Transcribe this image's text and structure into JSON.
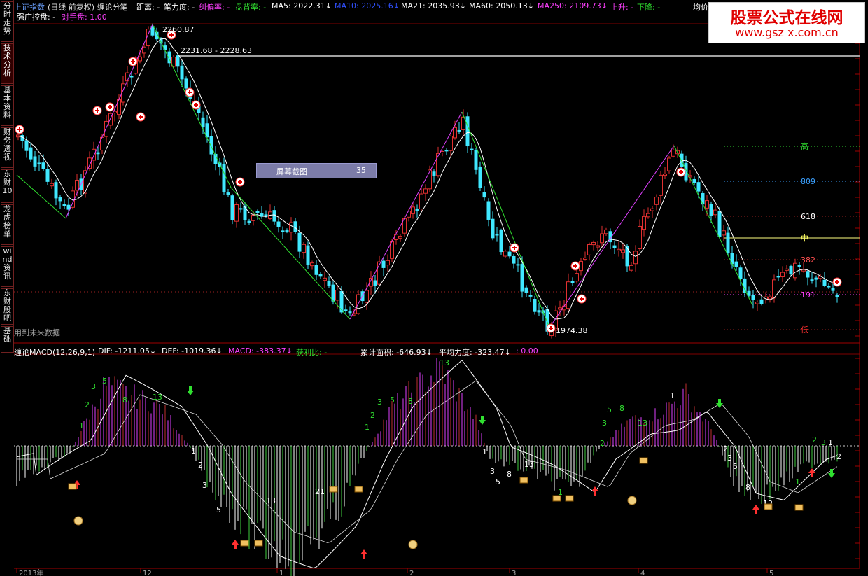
{
  "sidebar": {
    "tabs": [
      {
        "label": "分时走势",
        "active": false
      },
      {
        "label": "技术分析",
        "active": true
      },
      {
        "label": "基本资料",
        "active": false
      },
      {
        "label": "财务透视",
        "active": false
      },
      {
        "label": "东财10",
        "active": false
      },
      {
        "label": "龙虎榜单",
        "active": false
      },
      {
        "label": "wind资讯",
        "active": false
      },
      {
        "label": "东财股吧",
        "active": false
      },
      {
        "label": "基础",
        "active": false
      }
    ]
  },
  "header": {
    "row1": [
      {
        "text": "上证指数",
        "color": "#6aa0ff"
      },
      {
        "text": "(日线 前复权) 缠论分笔",
        "color": "#dddddd"
      },
      {
        "text": "距离: -",
        "color": "#ffffff"
      },
      {
        "text": "笔力度: -",
        "color": "#ffffff"
      },
      {
        "text": "纠偏率: -",
        "color": "#ff40ff"
      },
      {
        "text": "盘背率: -",
        "color": "#30e030"
      },
      {
        "text": "MA5: 2022.31↓",
        "color": "#ffffff"
      },
      {
        "text": "MA10: 2025.16↓",
        "color": "#3050ff"
      },
      {
        "text": "MA21: 2035.93↓",
        "color": "#ffffff"
      },
      {
        "text": "MA60: 2050.13↓",
        "color": "#ffffff"
      },
      {
        "text": "MA250: 2109.73↓",
        "color": "#ff40ff"
      },
      {
        "text": "上升: -",
        "color": "#ff40ff"
      },
      {
        "text": "下降: -",
        "color": "#30e030"
      },
      {
        "text": "均价",
        "color": "#ffffff"
      }
    ],
    "row2": [
      {
        "text": "强庄控盘: -",
        "color": "#ffffff"
      },
      {
        "text": "对手盘: 1.00",
        "color": "#ff40ff"
      }
    ]
  },
  "watermark": {
    "title": "股票公式在线网",
    "url": "www.gsz x.com.cn"
  },
  "screenshot_tip": {
    "label": "屏幕截图",
    "count": "35"
  },
  "price_chart": {
    "high_label": "2260.87",
    "range_label": "2231.68 - 2228.63",
    "low_label": "1974.38",
    "future_label": "用到未来数据",
    "fib_levels": [
      {
        "label": "高",
        "color": "#30e030"
      },
      {
        "label": "809",
        "color": "#3aa0ff"
      },
      {
        "label": "618",
        "color": "#ffffff"
      },
      {
        "label": "中",
        "color": "#ffff60"
      },
      {
        "label": "382",
        "color": "#ff5050"
      },
      {
        "label": "191",
        "color": "#ff40ff"
      },
      {
        "label": "低",
        "color": "#ff3030"
      }
    ]
  },
  "macd_header": [
    {
      "text": "缠论MACD(12,26,9,1)",
      "color": "#ffffff"
    },
    {
      "text": "DIF: -1211.05↓",
      "color": "#ffffff"
    },
    {
      "text": "DEF: -1019.36↓",
      "color": "#ffffff"
    },
    {
      "text": "MACD: -383.37↓",
      "color": "#ff40ff"
    },
    {
      "text": "获利比: -",
      "color": "#30e030"
    },
    {
      "text": "累计面积: -646.93↓",
      "color": "#ffffff"
    },
    {
      "text": "平均力度: -323.47↓",
      "color": "#ffffff"
    },
    {
      "text": ": 0.00",
      "color": "#ff40ff"
    }
  ],
  "macd_numbers": [
    {
      "t": "1",
      "c": "#30e030"
    },
    {
      "t": "2",
      "c": "#30e030"
    },
    {
      "t": "3",
      "c": "#30e030"
    },
    {
      "t": "5",
      "c": "#30e030"
    },
    {
      "t": "8",
      "c": "#30e030"
    },
    {
      "t": "13",
      "c": "#30e030"
    },
    {
      "t": "1",
      "c": "#ffffff"
    },
    {
      "t": "2",
      "c": "#ffffff"
    },
    {
      "t": "3",
      "c": "#ffffff"
    },
    {
      "t": "5",
      "c": "#ffffff"
    },
    {
      "t": "13",
      "c": "#ffffff"
    },
    {
      "t": "21",
      "c": "#ffffff"
    },
    {
      "t": "1",
      "c": "#30e030"
    },
    {
      "t": "2",
      "c": "#30e030"
    },
    {
      "t": "3",
      "c": "#30e030"
    },
    {
      "t": "5",
      "c": "#30e030"
    },
    {
      "t": "8",
      "c": "#30e030"
    },
    {
      "t": "13",
      "c": "#30e030"
    },
    {
      "t": "1",
      "c": "#ffffff"
    },
    {
      "t": "3",
      "c": "#ffffff"
    },
    {
      "t": "5",
      "c": "#ffffff"
    },
    {
      "t": "8",
      "c": "#ffffff"
    },
    {
      "t": "13",
      "c": "#ffffff"
    },
    {
      "t": "1",
      "c": "#30e030"
    },
    {
      "t": "2",
      "c": "#30e030"
    },
    {
      "t": "3",
      "c": "#30e030"
    },
    {
      "t": "5",
      "c": "#30e030"
    },
    {
      "t": "8",
      "c": "#30e030"
    },
    {
      "t": "13",
      "c": "#30e030"
    },
    {
      "t": "1",
      "c": "#ffffff"
    },
    {
      "t": "2",
      "c": "#ffffff"
    },
    {
      "t": "3",
      "c": "#ffffff"
    },
    {
      "t": "5",
      "c": "#ffffff"
    },
    {
      "t": "8",
      "c": "#ffffff"
    },
    {
      "t": "13",
      "c": "#ffffff"
    },
    {
      "t": "1",
      "c": "#30e030"
    },
    {
      "t": "2",
      "c": "#30e030"
    },
    {
      "t": "3",
      "c": "#30e030"
    },
    {
      "t": "1",
      "c": "#ffffff"
    },
    {
      "t": "2",
      "c": "#ffffff"
    }
  ],
  "date_axis": [
    "2013年",
    "12",
    "1",
    "2",
    "3",
    "4",
    "5"
  ],
  "colors": {
    "up": "#e03030",
    "down": "#40e8ff",
    "dotted_grid": "#7a1010",
    "frame": "#800000"
  }
}
